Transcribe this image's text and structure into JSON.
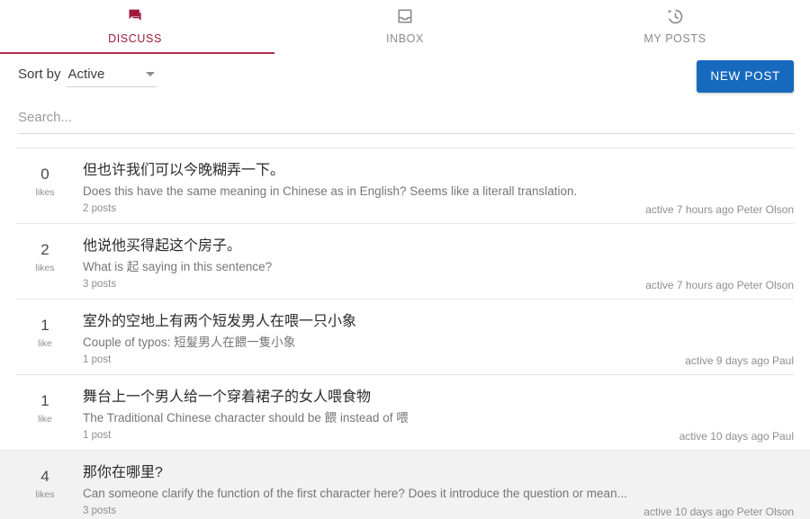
{
  "colors": {
    "accent_maroon": "#9e1b3c",
    "accent_underline": "#b02a4c",
    "button_blue": "#1769bd",
    "row_highlight": "#f2f2f2",
    "divider": "#e6e6e6"
  },
  "tabs": [
    {
      "label": "DISCUSS",
      "icon": "forum-icon",
      "active": true
    },
    {
      "label": "INBOX",
      "icon": "inbox-icon",
      "active": false
    },
    {
      "label": "MY POSTS",
      "icon": "history-icon",
      "active": false
    }
  ],
  "toolbar": {
    "sort_label": "Sort by",
    "sort_value": "Active",
    "new_post_label": "NEW POST"
  },
  "search": {
    "value": "",
    "placeholder": "Search..."
  },
  "posts": [
    {
      "likes": "0",
      "likes_label": "likes",
      "title": "但也许我们可以今晚糊弄一下。",
      "excerpt": "Does this have the same meaning in Chinese as in English? Seems like a literall translation.",
      "posts_count": "2 posts",
      "meta": "active 7 hours ago Peter Olson",
      "highlighted": false
    },
    {
      "likes": "2",
      "likes_label": "likes",
      "title": "他说他买得起这个房子。",
      "excerpt": "What is 起 saying in this sentence?",
      "posts_count": "3 posts",
      "meta": "active 7 hours ago Peter Olson",
      "highlighted": false
    },
    {
      "likes": "1",
      "likes_label": "like",
      "title": "室外的空地上有两个短发男人在喂一只小象",
      "excerpt": "Couple of typos: 短髮男人在餵一隻小象",
      "posts_count": "1 post",
      "meta": "active 9 days ago Paul",
      "highlighted": false
    },
    {
      "likes": "1",
      "likes_label": "like",
      "title": "舞台上一个男人给一个穿着裙子的女人喂食物",
      "excerpt": "The Traditional Chinese character should be 餵 instead of 喂",
      "posts_count": "1 post",
      "meta": "active 10 days ago Paul",
      "highlighted": false
    },
    {
      "likes": "4",
      "likes_label": "likes",
      "title": "那你在哪里?",
      "excerpt": "Can someone clarify the function of the first character here? Does it introduce the question or mean...",
      "posts_count": "3 posts",
      "meta": "active 10 days ago Peter Olson",
      "highlighted": true
    }
  ]
}
